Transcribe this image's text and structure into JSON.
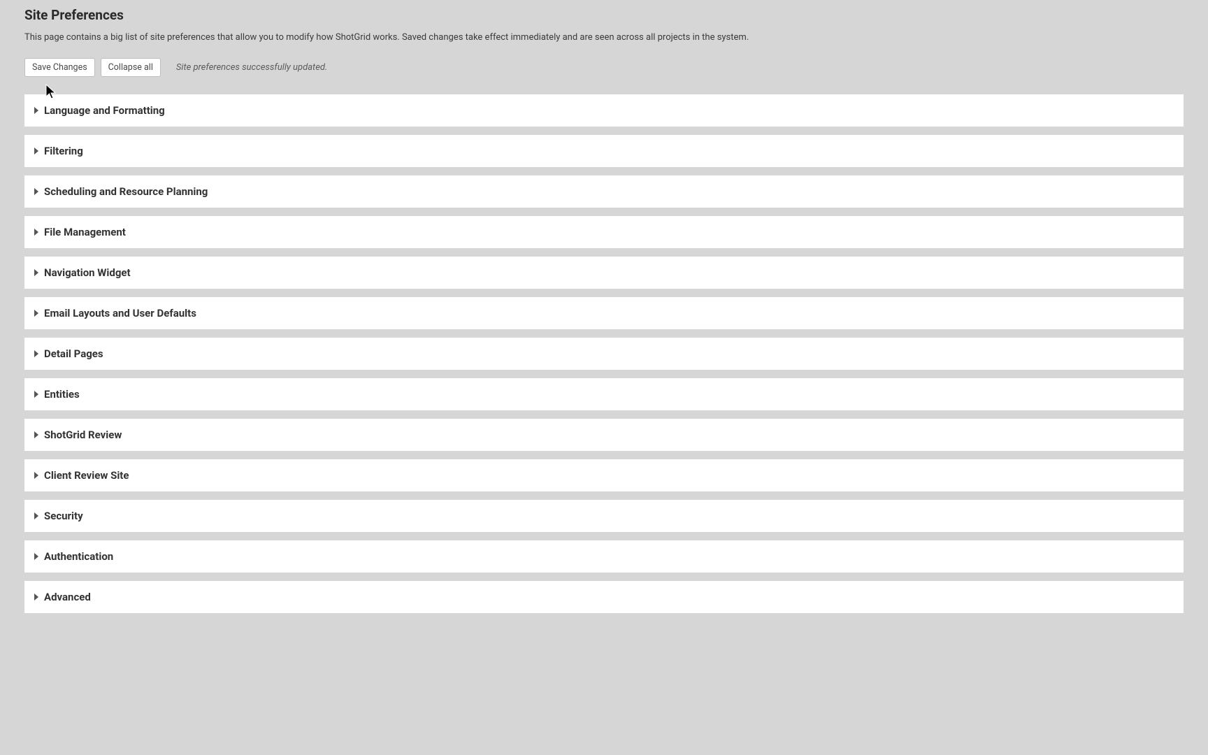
{
  "header": {
    "title": "Site Preferences",
    "description": "This page contains a big list of site preferences that allow you to modify how ShotGrid works. Saved changes take effect immediately and are seen across all projects in the system."
  },
  "toolbar": {
    "save_label": "Save Changes",
    "collapse_label": "Collapse all",
    "status_message": "Site preferences successfully updated."
  },
  "sections": [
    {
      "title": "Language and Formatting"
    },
    {
      "title": "Filtering"
    },
    {
      "title": "Scheduling and Resource Planning"
    },
    {
      "title": "File Management"
    },
    {
      "title": "Navigation Widget"
    },
    {
      "title": "Email Layouts and User Defaults"
    },
    {
      "title": "Detail Pages"
    },
    {
      "title": "Entities"
    },
    {
      "title": "ShotGrid Review"
    },
    {
      "title": "Client Review Site"
    },
    {
      "title": "Security"
    },
    {
      "title": "Authentication"
    },
    {
      "title": "Advanced"
    }
  ]
}
